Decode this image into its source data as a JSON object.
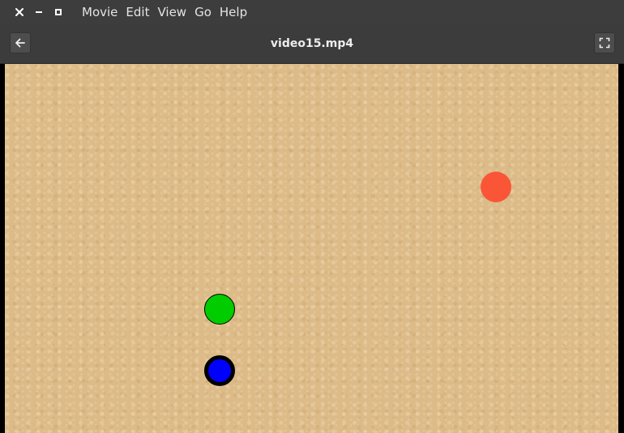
{
  "window": {
    "buttons": {
      "close": "✕",
      "minimize": "–",
      "maximize": "□"
    }
  },
  "menu": {
    "items": [
      {
        "label": "Movie"
      },
      {
        "label": "Edit"
      },
      {
        "label": "View"
      },
      {
        "label": "Go"
      },
      {
        "label": "Help"
      }
    ]
  },
  "header": {
    "title": "video15.mp4",
    "back_icon": "arrow-left-icon",
    "fullscreen_icon": "fullscreen-icon"
  },
  "video": {
    "background_color": "#dcbb88",
    "balls": [
      {
        "name": "red-ball",
        "color": "#fa5537"
      },
      {
        "name": "green-ball",
        "color": "#00cc00"
      },
      {
        "name": "blue-ball",
        "color": "#0000ff"
      }
    ]
  }
}
